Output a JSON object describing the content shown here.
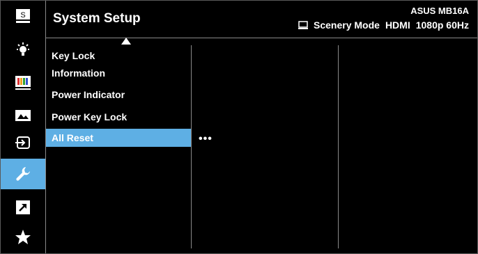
{
  "header": {
    "title": "System Setup",
    "model": "ASUS MB16A",
    "mode": "Scenery Mode",
    "input": "HDMI",
    "resolution": "1080p 60Hz"
  },
  "sidebar": {
    "items": [
      {
        "name": "splendid",
        "icon": "s-box-icon",
        "active": false
      },
      {
        "name": "eye-care",
        "icon": "bulb-icon",
        "active": false
      },
      {
        "name": "color",
        "icon": "color-bars-icon",
        "active": false
      },
      {
        "name": "image",
        "icon": "image-icon",
        "active": false
      },
      {
        "name": "input-select",
        "icon": "input-icon",
        "active": false
      },
      {
        "name": "system-setup",
        "icon": "wrench-icon",
        "active": true
      },
      {
        "name": "shortcut",
        "icon": "shortcut-arrow-icon",
        "active": false
      },
      {
        "name": "favorites",
        "icon": "star-icon",
        "active": false
      }
    ]
  },
  "menu": {
    "items": [
      {
        "label": "Key Lock",
        "selected": false
      },
      {
        "label": "Information",
        "selected": false
      },
      {
        "label": "Power Indicator",
        "selected": false
      },
      {
        "label": "Power Key Lock",
        "selected": false
      },
      {
        "label": "All Reset",
        "selected": true
      }
    ],
    "submenu_hint": "•••"
  },
  "colors": {
    "accent": "#5eafe4",
    "background": "#000000",
    "divider": "#8a8a8a"
  }
}
